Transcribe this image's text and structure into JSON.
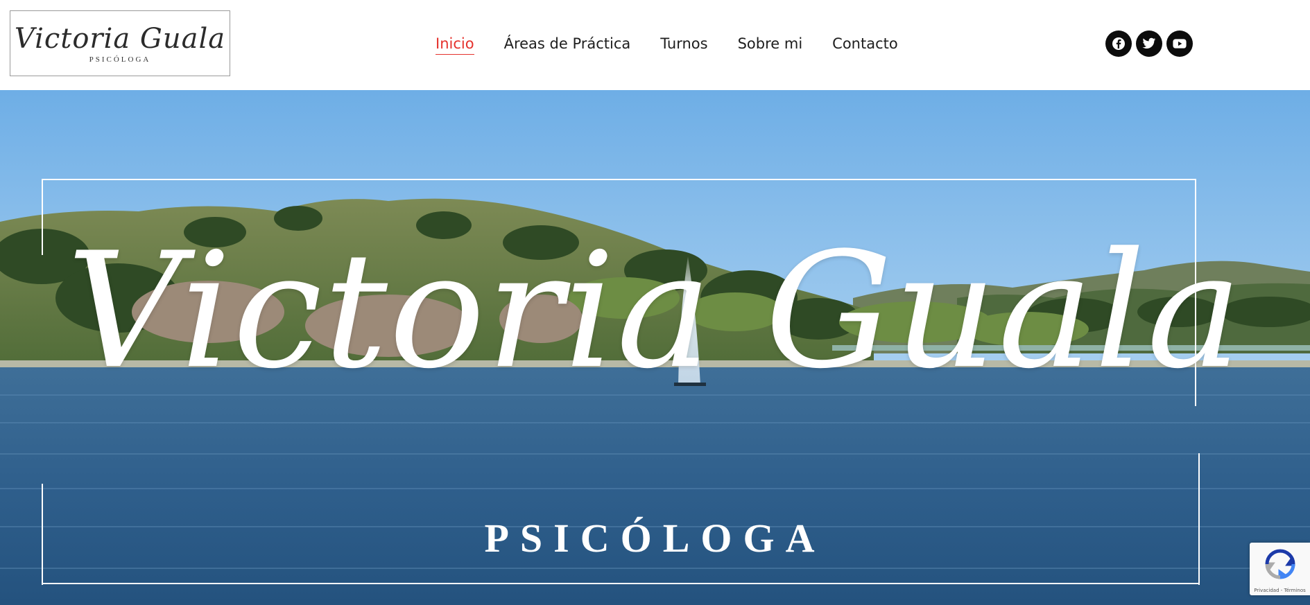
{
  "logo": {
    "name": "Victoria Guala",
    "subtitle": "PSICÓLOGA"
  },
  "nav": {
    "items": [
      {
        "label": "Inicio",
        "active": true
      },
      {
        "label": "Áreas de Práctica",
        "active": false
      },
      {
        "label": "Turnos",
        "active": false
      },
      {
        "label": "Sobre mi",
        "active": false
      },
      {
        "label": "Contacto",
        "active": false
      }
    ],
    "active_color": "#e5322d"
  },
  "socials": [
    {
      "icon": "facebook-icon"
    },
    {
      "icon": "twitter-icon"
    },
    {
      "icon": "youtube-icon"
    }
  ],
  "hero": {
    "title": "Victoria Guala",
    "subtitle": "PSICÓLOGA"
  },
  "recaptcha": {
    "terms": "Privacidad - Términos"
  }
}
